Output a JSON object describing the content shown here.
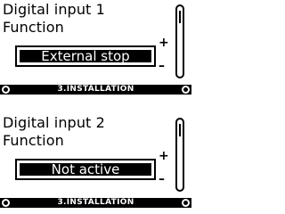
{
  "screens": [
    {
      "title": "Digital input 1",
      "subtitle": "Function",
      "value": "External stop",
      "plus": "+",
      "minus": "–",
      "footer": "3.INSTALLATION"
    },
    {
      "title": "Digital input 2",
      "subtitle": "Function",
      "value": "Not active",
      "plus": "+",
      "minus": "–",
      "footer": "3.INSTALLATION"
    }
  ],
  "icons": {
    "nav_left": "home-icon",
    "nav_right": "ok-icon"
  },
  "colors": {
    "background": "#ffffff",
    "foreground": "#000000",
    "highlight_text": "#ffffff"
  }
}
